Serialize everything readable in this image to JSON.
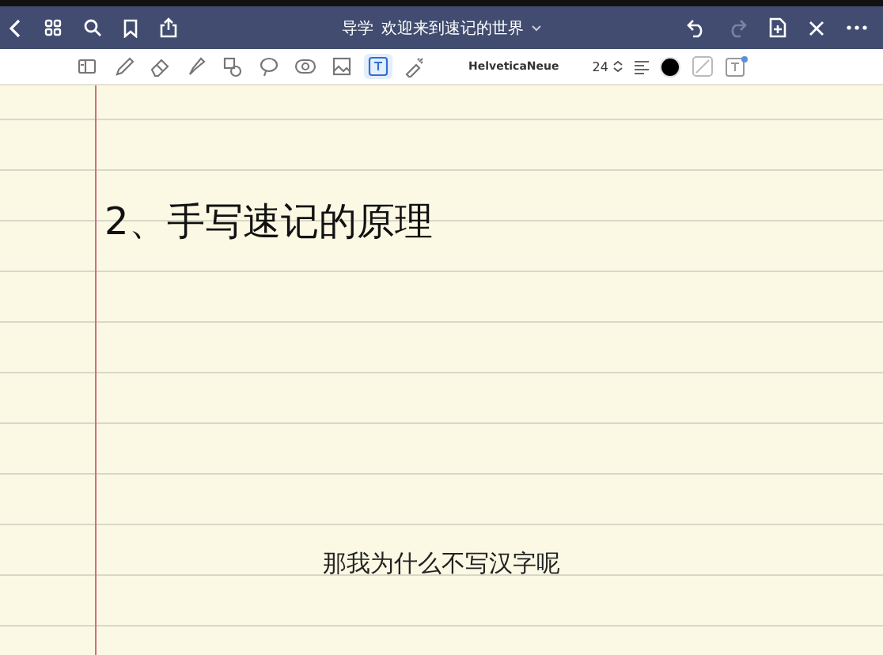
{
  "title_bar": {
    "notebook": "导学",
    "page_title": "欢迎来到速记的世界"
  },
  "toolbar": {
    "tools": [
      {
        "kind": "layout",
        "selected": false
      },
      {
        "kind": "pen",
        "selected": false
      },
      {
        "kind": "eraser",
        "selected": false
      },
      {
        "kind": "highlighter",
        "selected": false
      },
      {
        "kind": "shapes",
        "selected": false
      },
      {
        "kind": "lasso",
        "selected": false
      },
      {
        "kind": "sticker",
        "selected": false
      },
      {
        "kind": "image",
        "selected": false
      },
      {
        "kind": "text",
        "selected": true
      },
      {
        "kind": "laser",
        "selected": false
      }
    ],
    "font": "HelveticaNeue",
    "font_size": "24",
    "color": "#000000"
  },
  "page": {
    "heading": "2、手写速记的原理",
    "caption": "那我为什么不写汉字呢"
  }
}
